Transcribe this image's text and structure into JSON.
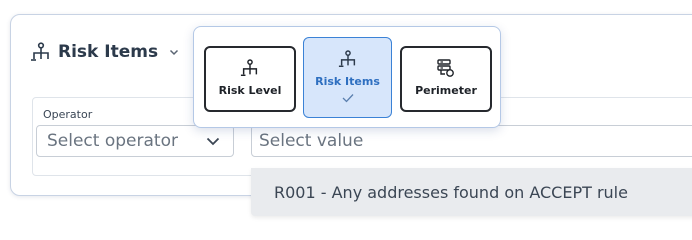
{
  "header": {
    "title": "Risk Items"
  },
  "filter": {
    "operator_label": "Operator",
    "operator_placeholder": "Select operator",
    "value_placeholder": "Select value"
  },
  "popover": {
    "options": [
      {
        "label": "Risk Level",
        "icon": "hierarchy-icon",
        "selected": false
      },
      {
        "label": "Risk Items",
        "icon": "hierarchy-icon",
        "selected": true
      },
      {
        "label": "Perimeter",
        "icon": "server-icon",
        "selected": false
      }
    ]
  },
  "dropdown": {
    "options": [
      "R001 - Any addresses found on ACCEPT rule"
    ]
  },
  "colors": {
    "accent": "#3b82d6",
    "selected_bg": "#d7e6fb",
    "border": "#c8d3e4",
    "dropdown_bg": "#e9ebee"
  }
}
